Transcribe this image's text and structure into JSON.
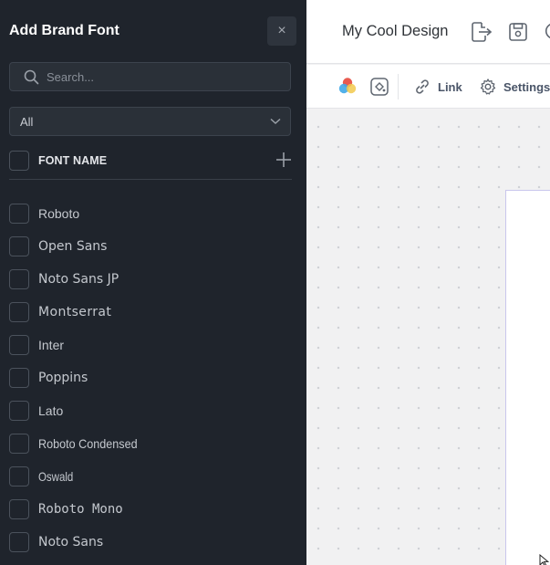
{
  "panel": {
    "title": "Add Brand Font",
    "close_glyph": "×",
    "search": {
      "placeholder": "Search..."
    },
    "filter": {
      "selected": "All"
    },
    "header": {
      "label": "FONT NAME"
    },
    "fonts": [
      {
        "name": "Roboto",
        "family": "\"Liberation Sans\", sans-serif",
        "style": ""
      },
      {
        "name": "Open Sans",
        "family": "\"DejaVu Sans\", sans-serif",
        "style": ""
      },
      {
        "name": "Noto Sans JP",
        "family": "\"DejaVu Sans\", sans-serif",
        "style": ""
      },
      {
        "name": "Montserrat",
        "family": "\"DejaVu Sans\", sans-serif",
        "style": "letter-spacing:0.4px"
      },
      {
        "name": "Inter",
        "family": "\"Liberation Sans\", sans-serif",
        "style": ""
      },
      {
        "name": "Poppins",
        "family": "\"DejaVu Sans\", sans-serif",
        "style": ""
      },
      {
        "name": "Lato",
        "family": "\"Liberation Sans\", sans-serif",
        "style": ""
      },
      {
        "name": "Roboto Condensed",
        "family": "\"Liberation Sans\", sans-serif",
        "style": "transform:scaleX(0.9);transform-origin:left"
      },
      {
        "name": "Oswald",
        "family": "\"Liberation Sans\", sans-serif",
        "style": "transform:scaleX(0.82);transform-origin:left"
      },
      {
        "name": "Roboto Mono",
        "family": "\"DejaVu Sans Mono\", monospace",
        "style": ""
      },
      {
        "name": "Noto Sans",
        "family": "\"DejaVu Sans\", sans-serif",
        "style": ""
      }
    ]
  },
  "topbar": {
    "design_title": "My Cool Design"
  },
  "toolbar": {
    "link_label": "Link",
    "settings_label": "Settings"
  },
  "icons": {
    "search": "search-icon",
    "chevron": "chevron-down-icon",
    "plus": "plus-icon",
    "close": "close-icon",
    "collapse": "chevron-left-icon",
    "export": "export-icon",
    "save": "save-icon",
    "refresh": "refresh-icon",
    "colors": "color-palette-icon",
    "fill": "fill-icon",
    "link": "link-icon",
    "settings": "gear-icon",
    "cursor": "cursor-icon"
  }
}
